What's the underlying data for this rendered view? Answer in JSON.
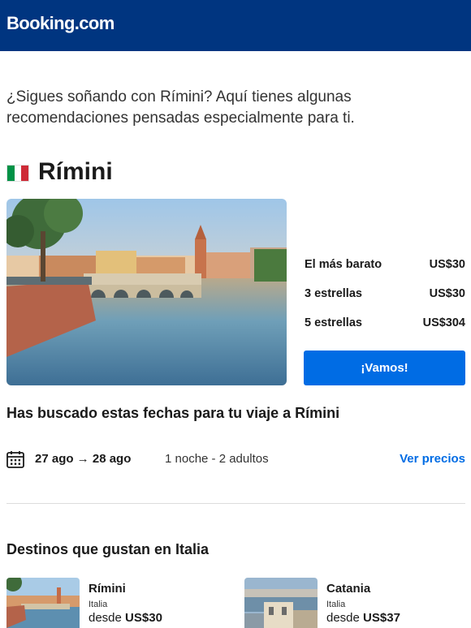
{
  "header": {
    "logo": "Booking.com",
    "bg_color": "#003580"
  },
  "intro": "¿Sigues soñando con Rímini? Aquí tienes algunas recomendaciones pensadas especialmente para ti.",
  "destination": {
    "flag_icon": "italy-flag-icon",
    "name": "Rímini",
    "prices": [
      {
        "label": "El más barato",
        "value": "US$30"
      },
      {
        "label": "3 estrellas",
        "value": "US$30"
      },
      {
        "label": "5 estrellas",
        "value": "US$304"
      }
    ],
    "cta_label": "¡Vamos!",
    "cta_color": "#006ce4"
  },
  "search": {
    "heading": "Has buscado estas fechas para tu viaje a Rímini",
    "calendar_icon": "calendar-icon",
    "dates": "27 ago → 28 ago",
    "guests": "1 noche - 2 adultos",
    "see_prices": "Ver precios"
  },
  "popular": {
    "heading": "Destinos que gustan en Italia",
    "cards": [
      {
        "name": "Rímini",
        "country": "Italia",
        "from_label": "desde",
        "price": "US$30"
      },
      {
        "name": "Catania",
        "country": "Italia",
        "from_label": "desde",
        "price": "US$37"
      }
    ]
  }
}
